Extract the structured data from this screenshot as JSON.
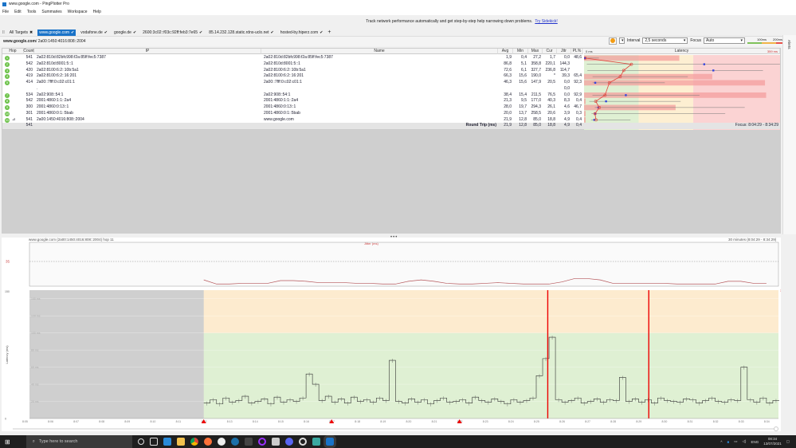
{
  "window": {
    "title": "www.google.com - PingPlotter Pro"
  },
  "menu": [
    "File",
    "Edit",
    "Tools",
    "Summaries",
    "Workspace",
    "Help"
  ],
  "banner": {
    "text": "Track network performance automatically and get step-by-step help narrowing down problems.",
    "link": "Try Sidekick!"
  },
  "tabs": [
    {
      "label": "All Targets",
      "active": false,
      "mark": "✖"
    },
    {
      "label": "www.google.com",
      "active": true,
      "mark": "✔"
    },
    {
      "label": "vodafone.de",
      "active": false,
      "mark": "✔"
    },
    {
      "label": "google.de",
      "active": false,
      "mark": "✔"
    },
    {
      "label": "2600:3c02::f03c:92ff:feb3:7e65",
      "active": false,
      "mark": "✔"
    },
    {
      "label": "85.14.232.128.static.rdns-uclo.net",
      "active": false,
      "mark": "✔"
    },
    {
      "label": "hosted-by.hiperz.com",
      "active": false,
      "mark": "✔"
    }
  ],
  "add_tab": "+",
  "breadcrumb": {
    "target": "www.google.com",
    "path": " / 2a00:1450:4016:808::2004"
  },
  "controls": {
    "interval_label": "Interval",
    "interval": "2,5 seconds",
    "focus_label": "Focus",
    "focus": "Auto",
    "legend_100": "100ms",
    "legend_200": "200ms",
    "side_tab": "Alerts"
  },
  "table": {
    "headers": {
      "hop": "Hop",
      "count": "Count",
      "ip": "IP",
      "name": "Name",
      "avg": "Avg",
      "min": "Min",
      "max": "Max",
      "cur": "Cur",
      "jttr": "Jttr",
      "pl": "PL%",
      "latency": "Latency",
      "lat_min": "0 ms",
      "lat_max": "359 ms"
    },
    "latency_scale_max": 359,
    "rows": [
      {
        "hop": "1",
        "count": "541",
        "ip": "2a02:810d:82bfc998:f2a:85ff:fec5:7387",
        "name": "2a02:810d:82bfc998:f2a:85ff:fec5:7387",
        "avg": "1,9",
        "min": "0,4",
        "max": "27,2",
        "cur": "1,7",
        "jttr": "0,0",
        "pl": "48,6",
        "v": [
          1.9,
          0.4,
          27.2,
          1.7
        ],
        "plv": 48.6
      },
      {
        "hop": "2",
        "count": "542",
        "ip": "2a02:810d:8001:5::1",
        "name": "2a02:810d:8001:5::1",
        "avg": "86,8",
        "min": "5,1",
        "max": "358,8",
        "cur": "220,1",
        "jttr": "144,3",
        "pl": "",
        "v": [
          86.8,
          5.1,
          358.8,
          220.1
        ],
        "plv": 0
      },
      {
        "hop": "3",
        "count": "420",
        "ip": "2a02:8100:6:2::10b:5a1",
        "name": "2a02:8100:6:2::10b:5a1",
        "avg": "72,6",
        "min": "6,1",
        "max": "327,7",
        "cur": "236,8",
        "jttr": "114,7",
        "pl": "",
        "v": [
          72.6,
          6.1,
          327.7,
          236.8
        ],
        "plv": 0
      },
      {
        "hop": "4",
        "count": "419",
        "ip": "2a02:8100:6:2::16:201",
        "name": "2a02:8100:6:2::16:201",
        "avg": "66,3",
        "min": "15,6",
        "max": "190,0",
        "cur": "*",
        "jttr": "39,3",
        "pl": "65,4",
        "v": [
          66.3,
          15.6,
          190,
          null
        ],
        "plv": 65.4
      },
      {
        "hop": "5",
        "count": "414",
        "ip": "2a00::7fff:0:c02:c01:1",
        "name": "2a00::7fff:0:c02:c01:1",
        "avg": "46,3",
        "min": "15,6",
        "max": "147,9",
        "cur": "20,5",
        "jttr": "0,0",
        "pl": "92,3",
        "v": [
          46.3,
          15.6,
          147.9,
          20.5
        ],
        "plv": 92.3
      },
      {
        "hop": "",
        "count": "",
        "ip": ".",
        "name": "",
        "avg": "",
        "min": "",
        "max": "",
        "cur": "",
        "jttr": "0,0",
        "pl": "",
        "v": null,
        "plv": 0
      },
      {
        "hop": "7",
        "count": "534",
        "ip": "2a02:908::54:1",
        "name": "2a02:908::54:1",
        "avg": "38,4",
        "min": "15,4",
        "max": "211,5",
        "cur": "76,5",
        "jttr": "0,0",
        "pl": "92,9",
        "v": [
          38.4,
          15.4,
          211.5,
          76.5
        ],
        "plv": 92.9
      },
      {
        "hop": "8",
        "count": "542",
        "ip": "2001:4860:1:1::2a4",
        "name": "2001:4860:1:1::2a4",
        "avg": "21,3",
        "min": "9,5",
        "max": "177,0",
        "cur": "40,3",
        "jttr": "8,3",
        "pl": "0,4",
        "v": [
          21.3,
          9.5,
          177,
          40.3
        ],
        "plv": 0.4
      },
      {
        "hop": "9",
        "count": "300",
        "ip": "2001:4860:0:13::1",
        "name": "2001:4860:0:13::1",
        "avg": "28,0",
        "min": "19,7",
        "max": "294,3",
        "cur": "26,1",
        "jttr": "4,6",
        "pl": "46,7",
        "v": [
          28,
          19.7,
          294.3,
          26.1
        ],
        "plv": 46.7
      },
      {
        "hop": "10",
        "count": "301",
        "ip": "2001:4860:0:1::5bab",
        "name": "2001:4860:0:1::5bab",
        "avg": "20,0",
        "min": "13,7",
        "max": "258,5",
        "cur": "20,6",
        "jttr": "3,9",
        "pl": "0,3",
        "v": [
          20,
          13.7,
          258.5,
          20.6
        ],
        "plv": 0.3
      },
      {
        "hop": "11",
        "count": "541",
        "ip": "2a00:1450:4016:808::2004",
        "name": "www.google.com",
        "avg": "21,9",
        "min": "12,8",
        "max": "85,0",
        "cur": "18,8",
        "jttr": "4,9",
        "pl": "0,4",
        "v": [
          21.9,
          12.8,
          85,
          18.8
        ],
        "plv": 0.4
      }
    ],
    "summary": {
      "count": "541",
      "label": "Round Trip (ms)",
      "avg": "21,9",
      "min": "12,8",
      "max": "85,0",
      "cur": "18,8",
      "jttr": "4,9",
      "pl": "0,4",
      "focus": "Focus: 8:04:29 - 8:34:29"
    }
  },
  "graph": {
    "title": "www.google.com (2a00:1450:4016:808::2004) hop 11",
    "range": "30 minutes (8:04:29 - 8:34:29)",
    "jitter_label": "Jitter (ms)",
    "jitter_ref": "35",
    "latency_axis": "Latency (ms)",
    "pl_axis": "Packet Loss %",
    "pl_max": "30",
    "y_ticks": [
      "150",
      "140 ms",
      "120 ms",
      "100 ms",
      "80 ms",
      "60 ms",
      "40 ms",
      "20 ms",
      "0"
    ],
    "x_ticks": [
      "8:05",
      "8:06",
      "8:07",
      "8:08",
      "8:09",
      "8:10",
      "8:11",
      "8:12",
      "8:13",
      "8:14",
      "8:15",
      "8:16",
      "8:17",
      "8:18",
      "8:19",
      "8:20",
      "8:21",
      "8:22",
      "8:23",
      "8:24",
      "8:25",
      "8:26",
      "8:27",
      "8:28",
      "8:29",
      "8:30",
      "8:31",
      "8:32",
      "8:33",
      "8:34"
    ]
  },
  "chart_data": {
    "type": "line",
    "ylim": [
      0,
      150
    ],
    "jitter_ylim": [
      0,
      63
    ],
    "start_minute": 12,
    "sample_seconds": 15,
    "latency": [
      18,
      22,
      17,
      24,
      19,
      21,
      26,
      18,
      20,
      23,
      17,
      25,
      19,
      22,
      20,
      24,
      52,
      40,
      21,
      26,
      19,
      23,
      18,
      25,
      20,
      22,
      19,
      24,
      21,
      68,
      20,
      18,
      23,
      19,
      22,
      17,
      21,
      24,
      19,
      20,
      22,
      18,
      25,
      21,
      19,
      23,
      20,
      17,
      22,
      19,
      21,
      24,
      50,
      70,
      95,
      22,
      19,
      21,
      24,
      18,
      20,
      23,
      19,
      22,
      21,
      48,
      20,
      23,
      19,
      22,
      18,
      24,
      21,
      20,
      19,
      23,
      22,
      18,
      21,
      24,
      20,
      19,
      22,
      21,
      60,
      22,
      19,
      24,
      18,
      21
    ],
    "jitter_sample_seconds": 30,
    "jitter": [
      8,
      2,
      2,
      3,
      3,
      3,
      7,
      7,
      6,
      4,
      4,
      4,
      3,
      3,
      2,
      2,
      6,
      8,
      6,
      3,
      2,
      2,
      3,
      4,
      3,
      2,
      2,
      2,
      5,
      10,
      10,
      8,
      3,
      3,
      3,
      3,
      3,
      2,
      2,
      2,
      2,
      6,
      6,
      3,
      3
    ],
    "loss_markers_minute": [
      12,
      17,
      22
    ],
    "loss_lines_minute": [
      25.45,
      29.4
    ]
  },
  "taskbar": {
    "search": "Type here to search",
    "lang": "ENG",
    "time": "08:34",
    "date": "13/07/2021"
  }
}
